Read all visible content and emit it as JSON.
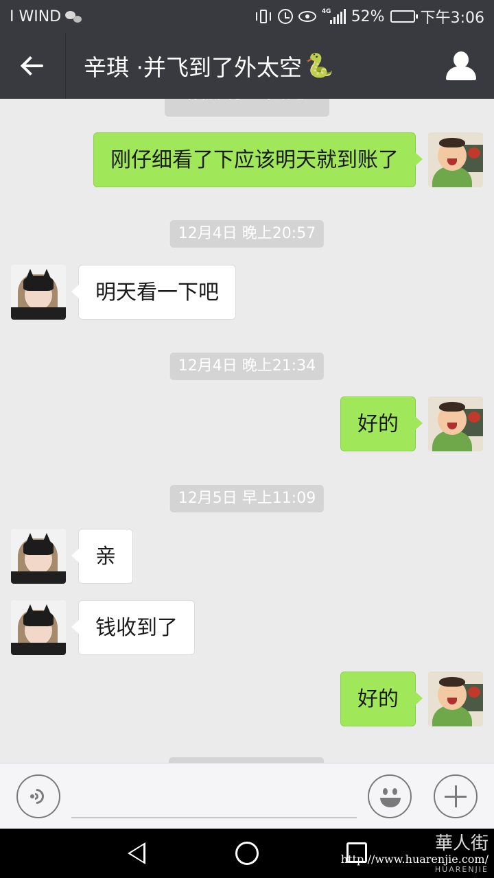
{
  "status_bar": {
    "carrier": "I WIND",
    "notification_icon": "wechat-icon",
    "network": "4G",
    "battery": "52%",
    "battery_level": 0.52,
    "time": "下午3:06"
  },
  "header": {
    "title": "辛琪 ·并飞到了外太空",
    "title_emoji": "🐍",
    "back_icon": "back-arrow-icon",
    "profile_icon": "person-icon"
  },
  "chat": {
    "system_note": "你撤回了一条消息",
    "timestamps": [
      "12月4日 晚上20:57",
      "12月4日 晚上21:34",
      "12月5日 早上11:09"
    ],
    "messages": [
      {
        "from": "me",
        "text": "刚仔细看了下应该明天就到账了"
      },
      {
        "from": "them",
        "text": "明天看一下吧"
      },
      {
        "from": "me",
        "text": "好的"
      },
      {
        "from": "them",
        "text": "亲"
      },
      {
        "from": "them",
        "text": "钱收到了"
      },
      {
        "from": "me",
        "text": "好的"
      }
    ]
  },
  "input_bar": {
    "voice_icon": "voice-icon",
    "emoji_icon": "emoji-icon",
    "plus_icon": "plus-icon"
  },
  "nav_bar": {
    "watermark_url": "http://www.huarenjie.com/",
    "watermark_brand": "HUARENJIE",
    "watermark_logo": "華人街"
  },
  "colors": {
    "header_bg": "#393a3f",
    "chat_bg": "#ebebeb",
    "bubble_out": "#a0e75a",
    "bubble_in": "#ffffff"
  }
}
